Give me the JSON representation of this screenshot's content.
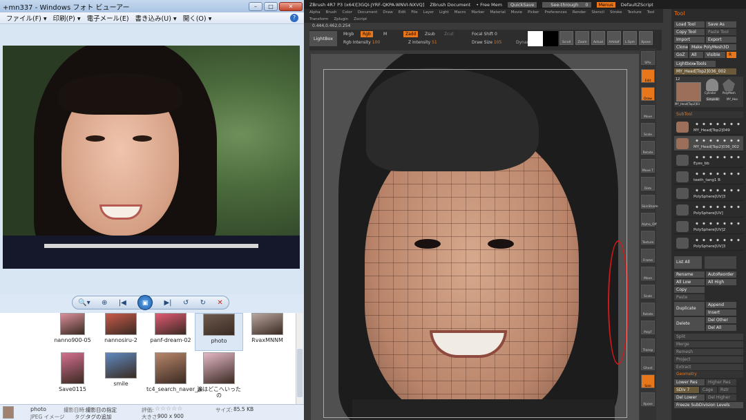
{
  "photo_viewer": {
    "title": "+mn337 - Windows フォト ビューアー",
    "menu": [
      "ファイル(F) ▾",
      "印刷(P) ▾",
      "電子メール(E)",
      "書き込み(U) ▾",
      "開く(O) ▾"
    ],
    "help_label": "?",
    "controls": {
      "zoom": "🔍▾",
      "fit": "⊕",
      "prev": "|◀",
      "slideshow": "▣",
      "next": "▶|",
      "rotate_left": "↺",
      "rotate_right": "↻",
      "delete": "✕"
    },
    "thumbnails": [
      {
        "label": "nanno900-05",
        "color": "#d98f9a"
      },
      {
        "label": "nannosiru-2",
        "color": "#c85a4a"
      },
      {
        "label": "panf-dream-02",
        "color": "#e25a73"
      },
      {
        "label": "photo",
        "color": "#6d5a4f",
        "selected": true
      },
      {
        "label": "RvaxMNNM",
        "color": "#b9a6a0"
      },
      {
        "label": "Save0115",
        "color": "#d46f8f"
      },
      {
        "label": "smile",
        "color": "#5f8ac0"
      },
      {
        "label": "tc4_search_naver_jp",
        "color": "#b8866a"
      },
      {
        "label": "涙はどこへいったの",
        "color": "#e4b8c6"
      }
    ],
    "status": {
      "name": "photo",
      "type": "JPEG イメージ",
      "date_label": "撮影日時:",
      "date_value": "撮影日の指定",
      "tag_label": "タグ:",
      "tag_value": "タグの追加",
      "rating_label": "評価:",
      "rating": "☆☆☆☆☆",
      "size_label": "大きさ:",
      "size_value": "900 x 900",
      "filesize_label": "サイズ:",
      "filesize_value": "85.5 KB"
    }
  },
  "zbrush": {
    "title": "ZBrush 4R7 P3 (x64)[3GQI-JYRF-QKPA-WNVI-NXVQ]",
    "doc": "ZBrush Document",
    "mem": "• Free Mem",
    "quicksave": "QuickSave",
    "seethrough": "See-through",
    "seethrough_val": "0",
    "menus": "Menus",
    "defaultzscript": "DefaultZScript",
    "menu": [
      "Alpha",
      "Brush",
      "Color",
      "Document",
      "Draw",
      "Edit",
      "File",
      "Layer",
      "Light",
      "Macro",
      "Marker",
      "Material",
      "Movie",
      "Picker",
      "Preferences",
      "Render",
      "Stencil",
      "Stroke",
      "Texture",
      "Tool"
    ],
    "submenu": [
      "Transform",
      "Zplugin",
      "Zscript"
    ],
    "coords": "0.444,0.462,0.254",
    "shelf": {
      "lightbox": "LightBox",
      "mrgb": "Mrgb",
      "rgb": "Rgb",
      "m": "M",
      "zadd": "Zadd",
      "zsub": "Zsub",
      "zcut": "Zcut",
      "rgb_intensity": "Rgb Intensity",
      "rgb_intensity_val": "100",
      "z_intensity": "Z Intensity",
      "z_intensity_val": "51",
      "focal_shift": "Focal Shift",
      "focal_shift_val": "0",
      "draw_size": "Draw Size",
      "draw_size_val": "105",
      "dynamic": "Dynamic",
      "icons": [
        "Scroll",
        "Zoom",
        "Actual",
        "AAHalf",
        "L.Sym",
        "Xpose"
      ]
    },
    "vtools": [
      "SPix",
      "Edit",
      "Draw",
      "Move",
      "Scale",
      "Rotate",
      "Move T",
      "Dots",
      "SkinShade",
      "Alpha_Off",
      "Texture",
      "Frame",
      "Move",
      "Scale",
      "Rotate",
      "PolyF",
      "Transp",
      "Ghost",
      "Solo",
      "Xpose"
    ],
    "tool_panel": {
      "header": "Tool",
      "buttons": [
        "Load Tool",
        "Save As",
        "Copy Tool",
        "Paste Tool",
        "Import",
        "Export",
        "Clone",
        "Make PolyMesh3D",
        "GoZ",
        "All",
        "Visible",
        "R"
      ],
      "lightbox_tools": "Lightbox▸Tools",
      "current": "MY_Head[Top2]036_002",
      "count": "12",
      "thumbs": [
        "MY_Head[Top2]03",
        "Cylinder",
        "PolyMesh",
        "SimpleBr",
        "MY_Hea"
      ],
      "subtool_header": "SubTool",
      "subtools": [
        "MY_Head[Top2]049",
        "MY_Head[Top2]036_002",
        "Eyes_bb",
        "teeth_tang1 B",
        "PolySphere[UV]3",
        "PolySphere[UV]",
        "PolySphere[UV]2",
        "PolySphere[UV]3"
      ],
      "list_all": "List All",
      "actions": [
        "Rename",
        "AutoReorder",
        "All Low",
        "All High",
        "Copy",
        "Paste",
        "Duplicate",
        "Append",
        "Insert",
        "Delete",
        "Del Other",
        "Del All",
        "Split",
        "Merge",
        "Remesh",
        "Project",
        "Extract"
      ],
      "geometry_header": "Geometry",
      "lower_res": "Lower Res",
      "higher_res": "Higher Res",
      "sdiv": "SDiv 7",
      "cage": "Cage",
      "rstr": "Rstr",
      "del_lower": "Del Lower",
      "del_higher": "Del Higher",
      "freeze": "Freeze SubDivision Levels"
    }
  }
}
